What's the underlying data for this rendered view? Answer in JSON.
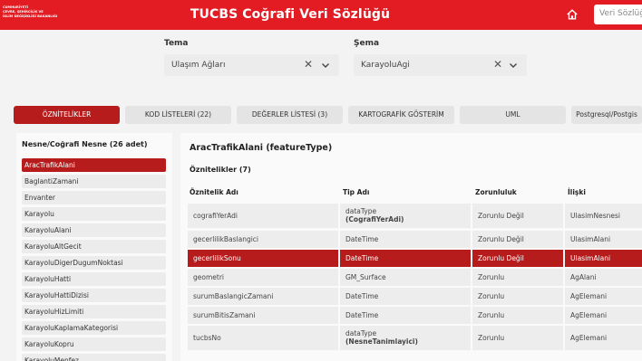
{
  "header": {
    "logo_lines": [
      "CUMHURİYETİ",
      "ÇEVRE, ŞEHİRCİLİK VE",
      "İKLİM DEĞİŞİKLİĞİ BAKANLIĞI"
    ],
    "title": "TUCBS Coğrafi Veri Sözlüğü",
    "search_placeholder": "Veri Sözlüğü"
  },
  "filters": {
    "tema_label": "Tema",
    "tema_value": "Ulaşım Ağları",
    "sema_label": "Şema",
    "sema_value": "KarayoluAgi"
  },
  "tabs": [
    {
      "label": "ÖZNİTELİKLER",
      "active": true
    },
    {
      "label": "KOD LİSTELERİ (22)",
      "active": false
    },
    {
      "label": "DEĞERLER LİSTESİ (3)",
      "active": false
    },
    {
      "label": "KARTOGRAFİK GÖSTERİM",
      "active": false
    },
    {
      "label": "UML",
      "active": false
    },
    {
      "label": "Postgresql/Postgis",
      "active": false
    }
  ],
  "left": {
    "title": "Nesne/Coğrafi Nesne (26 adet)",
    "items": [
      "AracTrafikAlani",
      "BaglantiZamani",
      "Envanter",
      "Karayolu",
      "KarayoluAlani",
      "KarayoluAltGecit",
      "KarayoluDigerDugumNoktasi",
      "KarayoluHatti",
      "KarayoluHattiDizisi",
      "KarayoluHizLimiti",
      "KarayoluKaplamaKategorisi",
      "KarayoluKopru",
      "KarayoluMenfez"
    ]
  },
  "right": {
    "title": "AracTrafikAlani (featureType)",
    "subtitle": "Öznitelikler (7)",
    "columns": [
      "Öznitelik Adı",
      "Tip Adı",
      "Zorunluluk",
      "İlişki"
    ],
    "rows": [
      {
        "name": "cografiYerAdi",
        "type": "dataType",
        "type_sub": "(CografiYerAdi)",
        "req": "Zorunlu Değil",
        "rel": "UlasimNesnesi"
      },
      {
        "name": "gecerlilikBaslangici",
        "type": "DateTime",
        "type_sub": "",
        "req": "Zorunlu Değil",
        "rel": "UlasimAlani"
      },
      {
        "name": "gecerlilikSonu",
        "type": "DateTime",
        "type_sub": "",
        "req": "Zorunlu Değil",
        "rel": "UlasimAlani"
      },
      {
        "name": "geometri",
        "type": "GM_Surface",
        "type_sub": "",
        "req": "Zorunlu",
        "rel": "AgAlani"
      },
      {
        "name": "surumBaslangicZamani",
        "type": "DateTime",
        "type_sub": "",
        "req": "Zorunlu",
        "rel": "AgElemani"
      },
      {
        "name": "surumBitisZamani",
        "type": "DateTime",
        "type_sub": "",
        "req": "Zorunlu",
        "rel": "AgElemani"
      },
      {
        "name": "tucbsNo",
        "type": "dataType",
        "type_sub": "(NesneTanimlayici)",
        "req": "Zorunlu",
        "rel": "AgElemani"
      }
    ]
  },
  "colors": {
    "brand": "#e31b23",
    "active": "#b71c1c"
  }
}
